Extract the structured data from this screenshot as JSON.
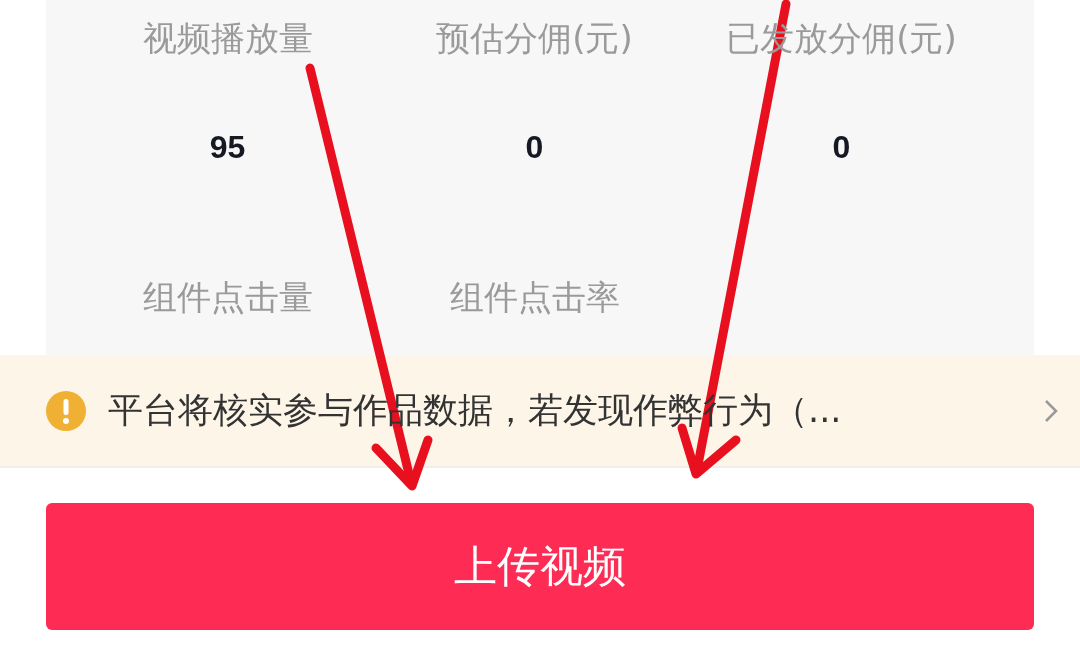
{
  "metrics": [
    {
      "label": "视频播放量",
      "value": "95"
    },
    {
      "label": "预估分佣(元)",
      "value": "0"
    },
    {
      "label": "已发放分佣(元)",
      "value": "0"
    },
    {
      "label": "组件点击量"
    },
    {
      "label": "组件点击率"
    }
  ],
  "notice": {
    "text": "平台将核实参与作品数据，若发现作弊行为（..."
  },
  "upload_button": {
    "label": "上传视频"
  }
}
